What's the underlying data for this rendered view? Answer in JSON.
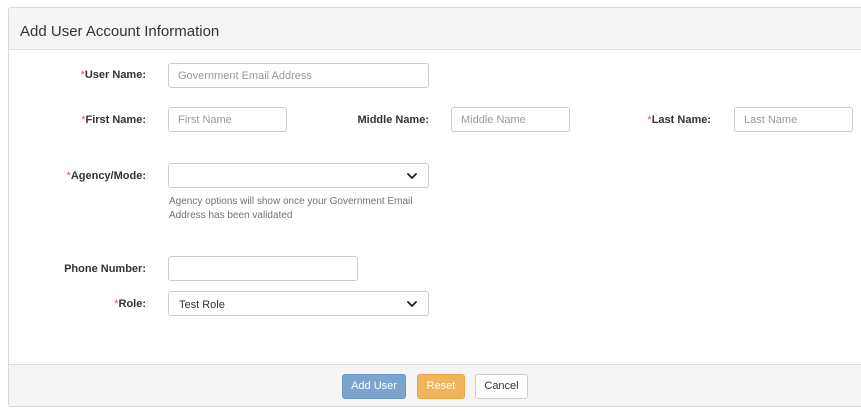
{
  "panel": {
    "title": "Add User Account Information"
  },
  "form": {
    "required_mark": "*",
    "user_name": {
      "label": "User Name:",
      "value": "",
      "placeholder": "Government Email Address"
    },
    "first_name": {
      "label": "First Name:",
      "value": "",
      "placeholder": "First Name"
    },
    "middle_name": {
      "label": "Middle Name:",
      "value": "",
      "placeholder": "Middle Name"
    },
    "last_name": {
      "label": "Last Name:",
      "value": "",
      "placeholder": "Last Name"
    },
    "agency_mode": {
      "label": "Agency/Mode:",
      "selected": "",
      "help": "Agency options will show once your Government Email Address has been validated"
    },
    "phone_number": {
      "label": "Phone Number:",
      "value": "",
      "placeholder": ""
    },
    "role": {
      "label": "Role:",
      "selected": "Test Role"
    }
  },
  "buttons": {
    "add_user": "Add User",
    "reset": "Reset",
    "cancel": "Cancel"
  },
  "icons": {
    "dropdown": "chevron-down-icon"
  },
  "colors": {
    "required": "#e05a4e",
    "primary_button": "#7ba5cf",
    "warning_button": "#f1b35b",
    "panel_heading_bg": "#f5f5f5"
  }
}
